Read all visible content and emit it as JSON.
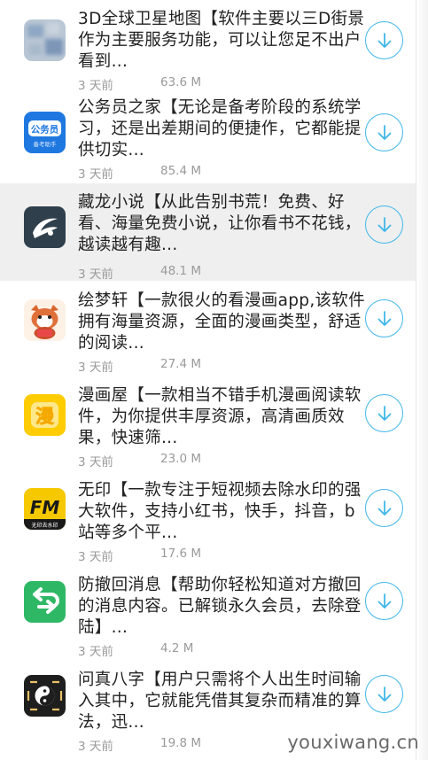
{
  "apps": [
    {
      "desc": "3D全球卫星地图【软件主要以三D街景作为主要服务功能，可以让您足不出户看到...",
      "time": "3 天前",
      "size": "63.6 M",
      "icon": "satellite-map-icon"
    },
    {
      "desc": "公务员之家【无论是备考阶段的系统学习，还是出差期间的便捷作，它都能提供切实...",
      "time": "3 天前",
      "size": "85.4 M",
      "icon": "civil-servant-icon",
      "icon_text_top": "公务员",
      "icon_text_bottom": "备考助手"
    },
    {
      "desc": "藏龙小说【从此告别书荒！免费、好看、海量免费小说，让你看书不花钱，越读越有趣...",
      "time": "3 天前",
      "size": "48.1 M",
      "icon": "novel-icon"
    },
    {
      "desc": "绘梦轩【一款很火的看漫画app,该软件拥有海量资源，全面的漫画类型，舒适的阅读...",
      "time": "3 天前",
      "size": "27.4 M",
      "icon": "red-panda-icon"
    },
    {
      "desc": "漫画屋【一款相当不错手机漫画阅读软件，为你提供丰厚资源，高清画质效果，快速筛...",
      "time": "3 天前",
      "size": "23.0 M",
      "icon": "manga-house-icon",
      "icon_text_top": "漫"
    },
    {
      "desc": "无印【一款专注于短视频去除水印的强大软件，支持小红书，快手，抖音，b站等多个平...",
      "time": "3 天前",
      "size": "17.6 M",
      "icon": "watermark-remover-icon",
      "icon_text_top": "FM",
      "icon_text_bottom": "无印去水印"
    },
    {
      "desc": "防撤回消息【帮助你轻松知道对方撤回的消息内容。已解锁永久会员，去除登陆】...",
      "time": "3 天前",
      "size": "4.2 M",
      "icon": "anti-recall-icon"
    },
    {
      "desc": "问真八字【用户只需将个人出生时间输入其中，它就能凭借其复杂而精准的算法，迅...",
      "time": "3 天前",
      "size": "19.8 M",
      "icon": "bazi-icon"
    }
  ],
  "watermark": "youxiwang.cn",
  "colors": {
    "accent": "#40b7e8",
    "highlight_row": "#efefef",
    "meta_text": "#9a9a9a"
  }
}
